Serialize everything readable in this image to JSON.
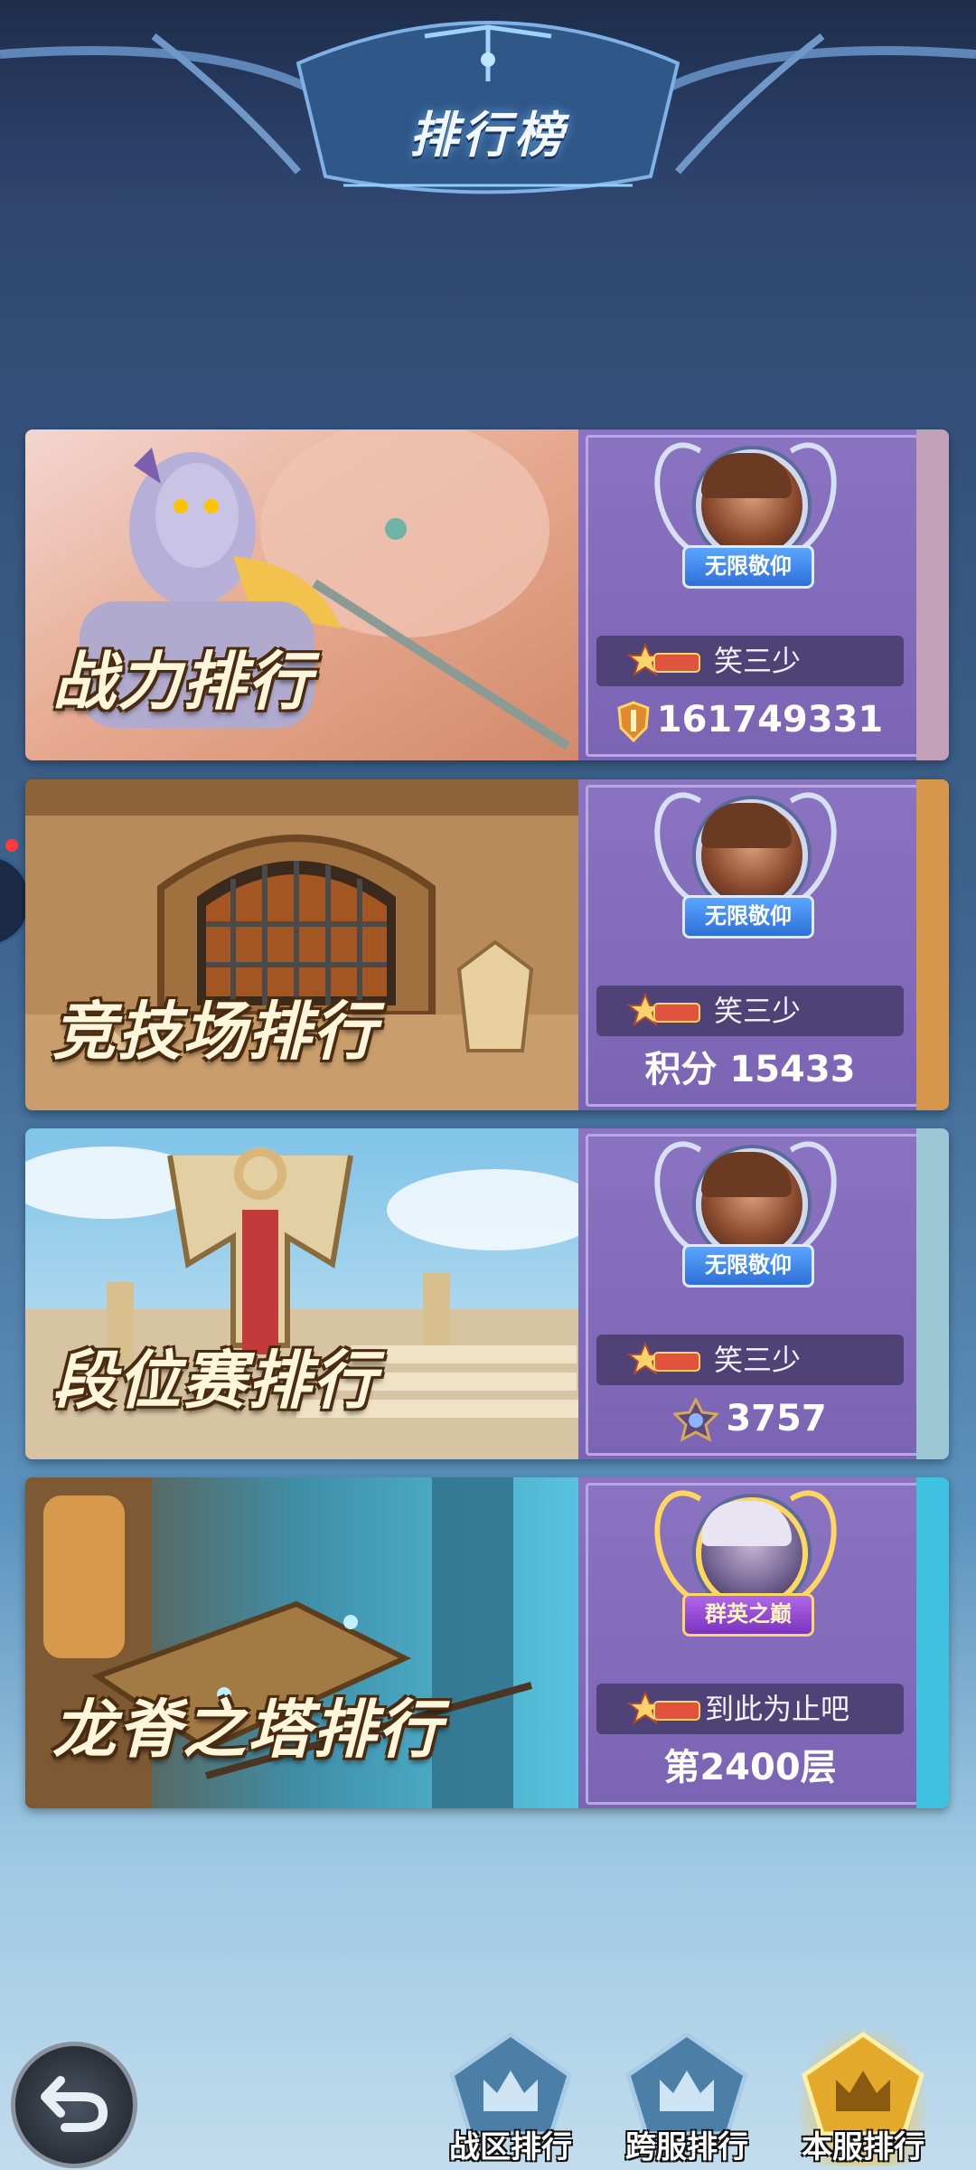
{
  "header": {
    "title": "排行榜"
  },
  "cards": [
    {
      "title": "战力排行",
      "badge": "无限敬仰",
      "player": "笑三少",
      "score": "161749331",
      "score_icon": "power-shield-icon"
    },
    {
      "title": "竞技场排行",
      "badge": "无限敬仰",
      "player": "笑三少",
      "score": "积分 15433",
      "score_icon": ""
    },
    {
      "title": "段位赛排行",
      "badge": "无限敬仰",
      "player": "笑三少",
      "score": "3757",
      "score_icon": "rank-emblem-icon"
    },
    {
      "title": "龙脊之塔排行",
      "badge": "群英之巅",
      "player": "到此为止吧",
      "score": "第2400层",
      "score_icon": ""
    }
  ],
  "bottom_nav": [
    {
      "label": "战区排行",
      "active": false
    },
    {
      "label": "跨服排行",
      "active": false
    },
    {
      "label": "本服排行",
      "active": true
    }
  ],
  "colors": {
    "panel": "#8a74c2",
    "accent_gold": "#ffd75e",
    "accent_blue": "#5aa6ff"
  }
}
